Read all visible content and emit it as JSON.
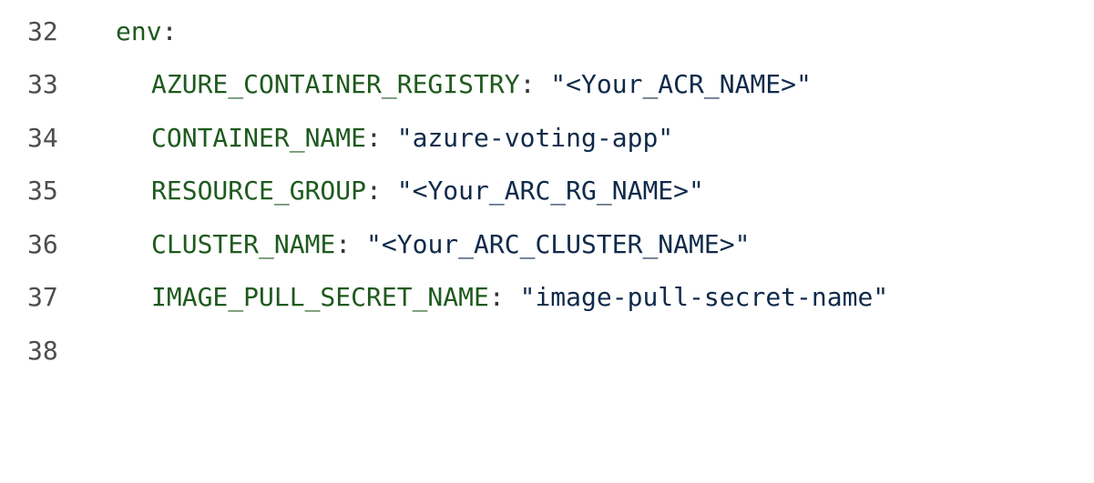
{
  "code": {
    "lines": [
      {
        "number": "32",
        "key": "env",
        "separator": ":",
        "value": ""
      },
      {
        "number": "33",
        "key": "AZURE_CONTAINER_REGISTRY",
        "separator": ": ",
        "value": "\"<Your_ACR_NAME>\""
      },
      {
        "number": "34",
        "key": "CONTAINER_NAME",
        "separator": ": ",
        "value": "\"azure-voting-app\""
      },
      {
        "number": "35",
        "key": "RESOURCE_GROUP",
        "separator": ": ",
        "value": "\"<Your_ARC_RG_NAME>\""
      },
      {
        "number": "36",
        "key": "CLUSTER_NAME",
        "separator": ": ",
        "value": "\"<Your_ARC_CLUSTER_NAME>\""
      },
      {
        "number": "37",
        "key": "IMAGE_PULL_SECRET_NAME",
        "separator": ": ",
        "value": "\"image-pull-secret-name\""
      },
      {
        "number": "38",
        "key": "",
        "separator": "",
        "value": ""
      }
    ]
  },
  "colors": {
    "background": "#ffffff",
    "line_number": "#4d4d4d",
    "key": "#1e5a1e",
    "string": "#0f2a4a"
  }
}
